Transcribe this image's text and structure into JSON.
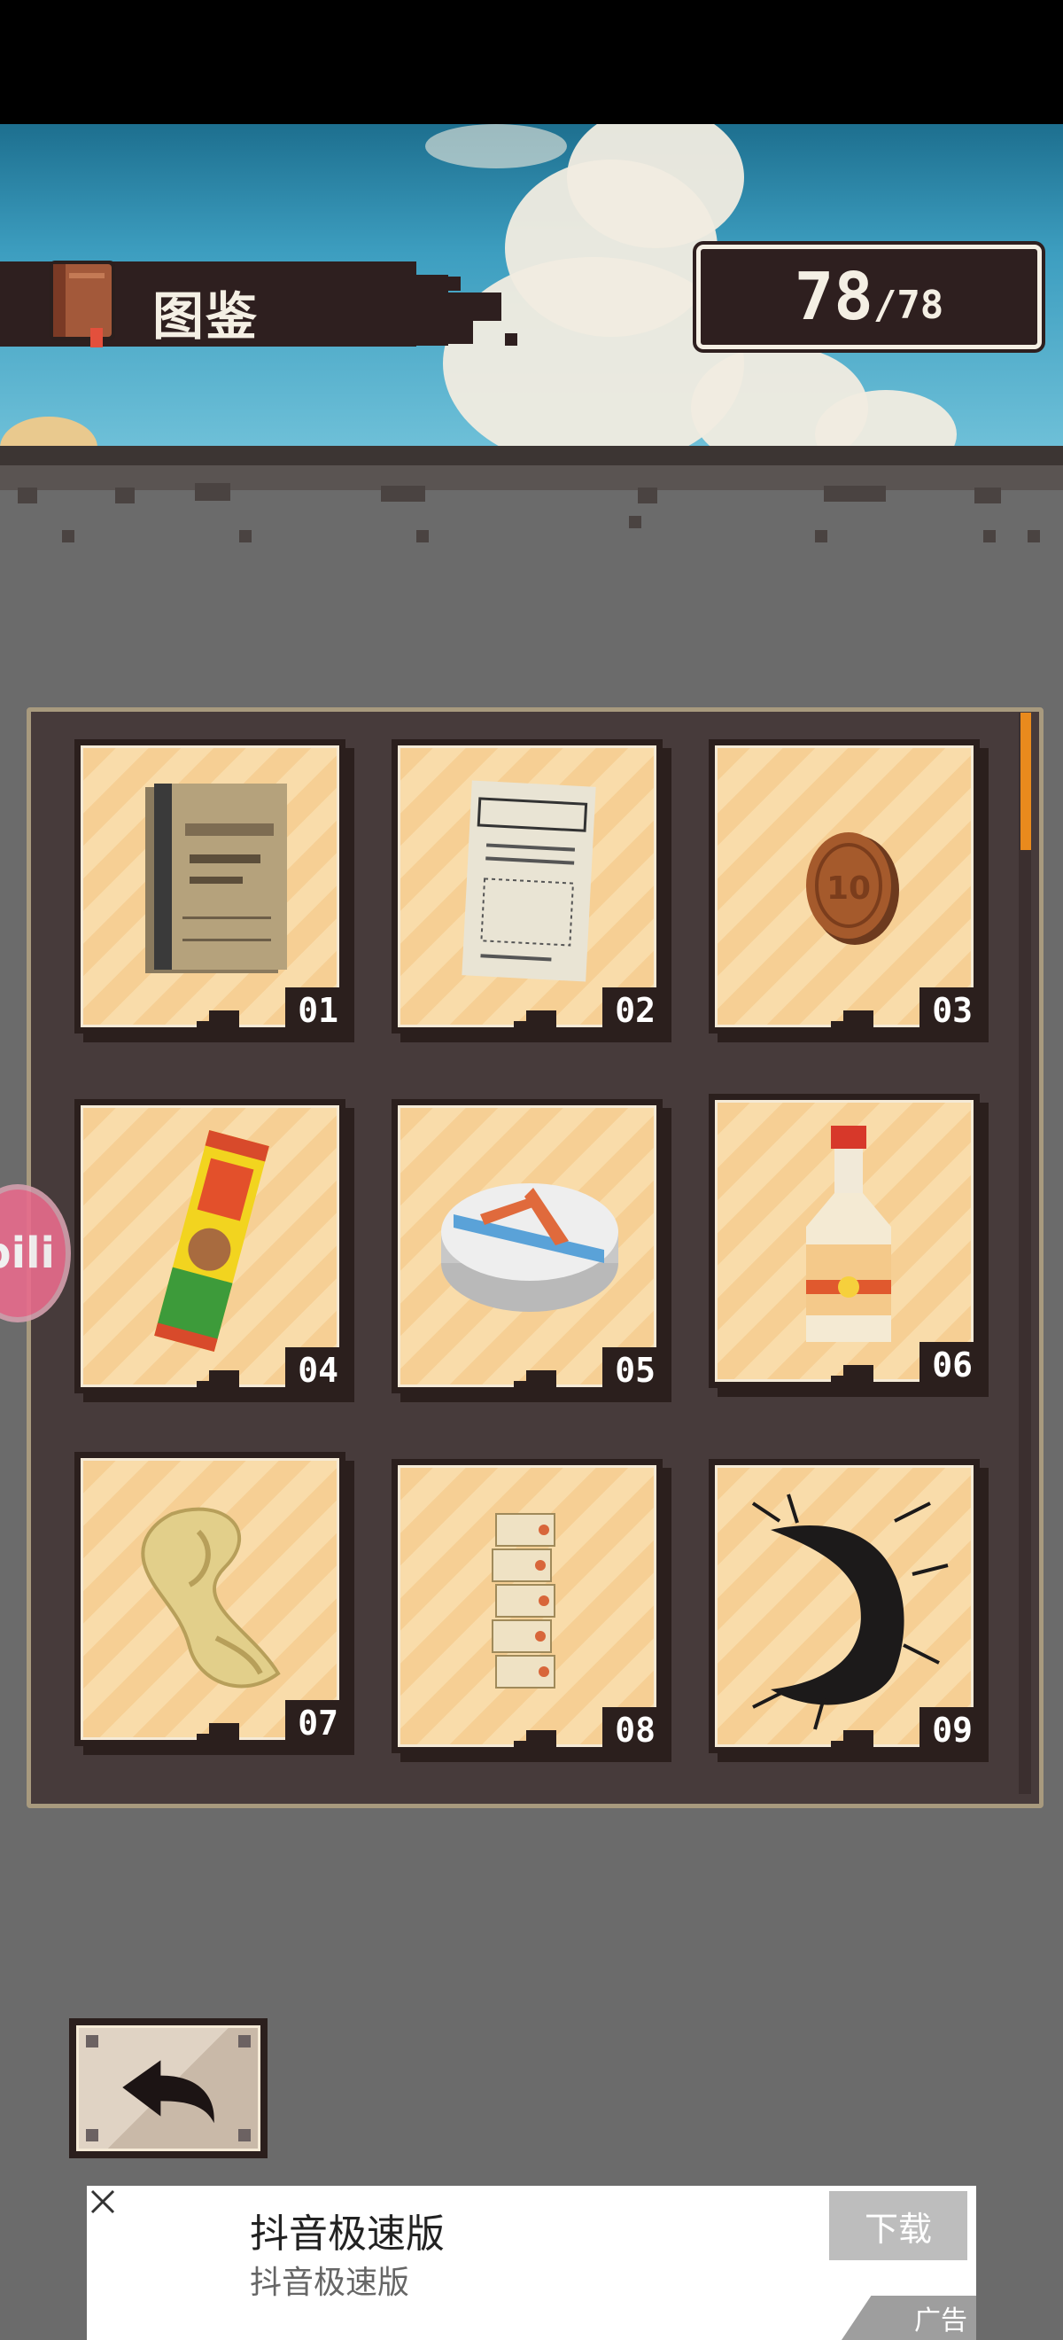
{
  "header": {
    "title": "图鉴",
    "collected": "78",
    "separator": "/",
    "total": "78"
  },
  "cards": [
    {
      "number": "01",
      "item": "notebook-icon"
    },
    {
      "number": "02",
      "item": "paper-document-icon"
    },
    {
      "number": "03",
      "item": "coin-icon"
    },
    {
      "number": "04",
      "item": "snack-bar-icon"
    },
    {
      "number": "05",
      "item": "rice-cake-icon"
    },
    {
      "number": "06",
      "item": "mirin-bottle-icon"
    },
    {
      "number": "07",
      "item": "dragon-figure-icon"
    },
    {
      "number": "08",
      "item": "ticket-strip-icon"
    },
    {
      "number": "09",
      "item": "black-seaweed-icon"
    }
  ],
  "side_badge": "bili",
  "back_button": {
    "icon": "back-arrow-icon"
  },
  "ad": {
    "title": "抖音极速版",
    "subtitle": "抖音极速版",
    "download": "下载",
    "label": "广告"
  },
  "colors": {
    "accent": "#e98a1d",
    "frame": "#2b1f1d",
    "card_stripe_a": "#f6cf94",
    "card_stripe_b": "#f9dcaa"
  }
}
